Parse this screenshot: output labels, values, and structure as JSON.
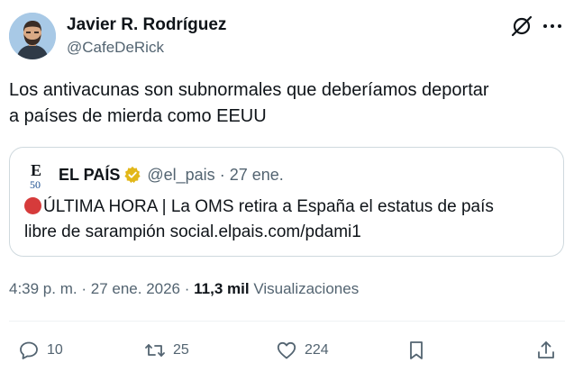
{
  "author": {
    "display_name": "Javier R. Rodríguez",
    "handle": "@CafeDeRick"
  },
  "tweet": {
    "text_line1": "Los antivacunas son subnormales que deberíamos deportar",
    "text_line2": "a países de mierda como EEUU"
  },
  "quote": {
    "name": "EL PAÍS",
    "handle": "@el_pais",
    "separator": "·",
    "time": "27 ene.",
    "text_line1": "ÚLTIMA HORA | La OMS retira a España el estatus de país",
    "text_line2": "libre de sarampión social.elpais.com/pdami1",
    "badge_color": "#e2b719"
  },
  "meta": {
    "time": "4:39 p. m.",
    "sep1": "·",
    "date": "27 ene. 2026",
    "sep2": "·",
    "views_count": "11,3 mil",
    "views_label": "Visualizaciones"
  },
  "actions": {
    "replies": "10",
    "retweets": "25",
    "likes": "224"
  },
  "icons": [
    "grok-icon",
    "more-icon",
    "reply-icon",
    "retweet-icon",
    "like-icon",
    "bookmark-icon",
    "share-icon",
    "verified-badge-icon",
    "red-circle-emoji"
  ],
  "colors": {
    "text": "#0f1419",
    "secondary": "#536471",
    "border": "#cfd9de",
    "avatar_bg": "#a8c9e6"
  }
}
